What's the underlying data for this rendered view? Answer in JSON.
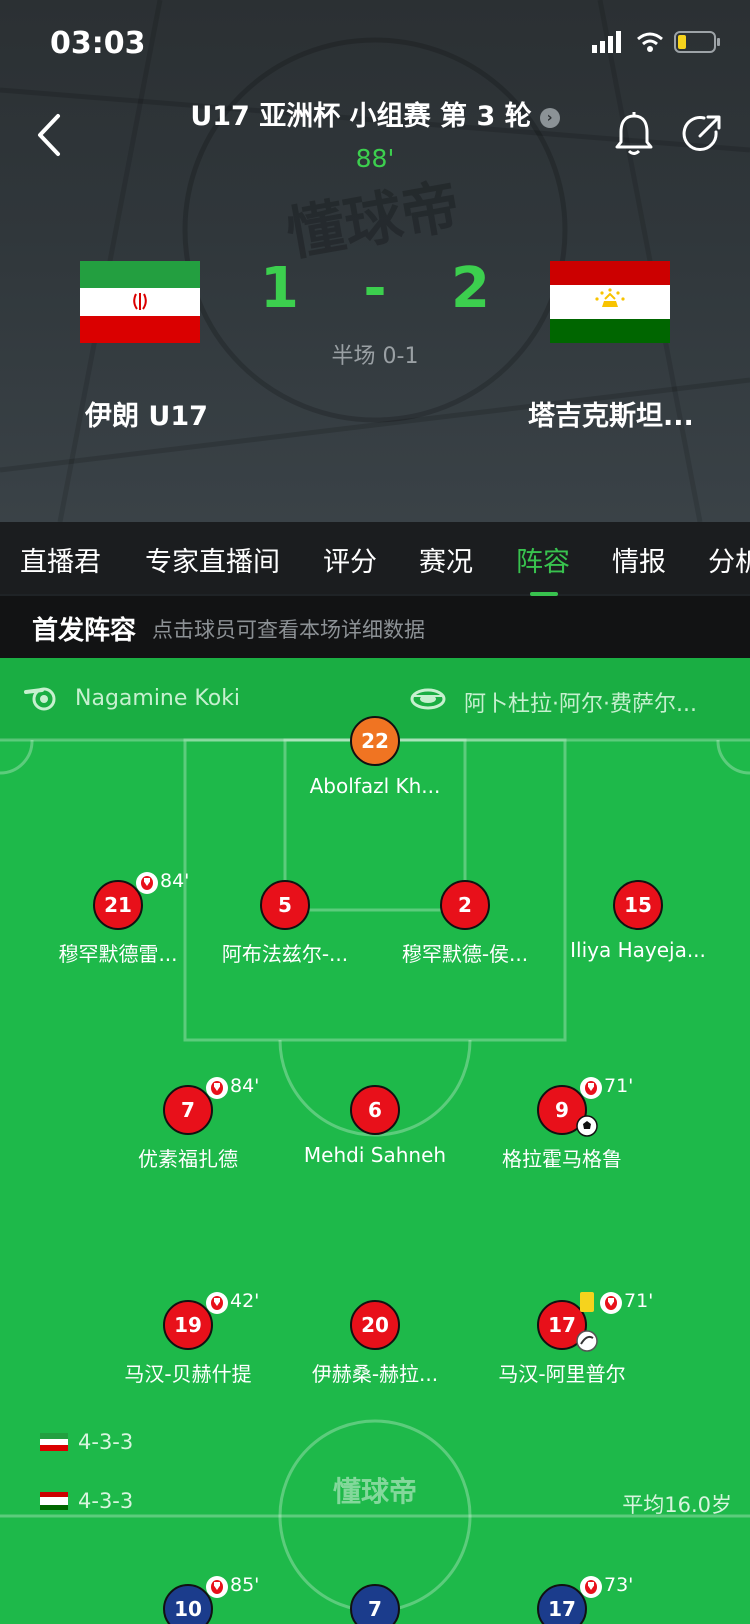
{
  "status_bar": {
    "time": "03:03"
  },
  "match": {
    "title": "U17 亚洲杯 小组赛 第 3 轮",
    "minute": "88'",
    "home_team": "伊朗 U17",
    "away_team": "塔吉克斯坦...",
    "home_score": "1",
    "separator": "-",
    "away_score": "2",
    "halftime": "半场 0-1",
    "watermark": "懂球帝"
  },
  "tabs": [
    {
      "label": "直播君"
    },
    {
      "label": "专家直播间"
    },
    {
      "label": "评分"
    },
    {
      "label": "赛况"
    },
    {
      "label": "阵容",
      "active": true
    },
    {
      "label": "情报"
    },
    {
      "label": "分析"
    }
  ],
  "section": {
    "title": "首发阵容",
    "subtitle": "点击球员可查看本场详细数据"
  },
  "pitch": {
    "referee": "Nagamine Koki",
    "venue": "阿卜杜拉·阿尔·费萨尔...",
    "watermark": "懂球帝",
    "home_formation": "4-3-3",
    "away_formation": "4-3-3",
    "avg_age": "平均16.0岁"
  },
  "players": [
    {
      "number": "22",
      "name": "Abolfazl Kh..."
    },
    {
      "number": "21",
      "name": "穆罕默德雷...",
      "sub_minute": "84'"
    },
    {
      "number": "5",
      "name": "阿布法兹尔-..."
    },
    {
      "number": "2",
      "name": "穆罕默德-侯..."
    },
    {
      "number": "15",
      "name": "Iliya Hayeja..."
    },
    {
      "number": "7",
      "name": "优素福扎德",
      "sub_minute": "84'"
    },
    {
      "number": "6",
      "name": "Mehdi Sahneh"
    },
    {
      "number": "9",
      "name": "格拉霍马格鲁",
      "sub_minute": "71'"
    },
    {
      "number": "19",
      "name": "马汉-贝赫什提",
      "sub_minute": "42'"
    },
    {
      "number": "20",
      "name": "伊赫桑-赫拉..."
    },
    {
      "number": "17",
      "name": "马汉-阿里普尔",
      "sub_minute": "71'"
    },
    {
      "number": "10",
      "name": "",
      "sub_minute": "85'"
    },
    {
      "number": "7",
      "name": ""
    },
    {
      "number": "17",
      "name": "",
      "sub_minute": "73'"
    }
  ],
  "colors": {
    "accent": "#38c24e",
    "pitch": "#1eb94a",
    "home_kit": "#e8101a",
    "goalkeeper_kit": "#f07422",
    "away_kit": "#1b3c8c"
  }
}
